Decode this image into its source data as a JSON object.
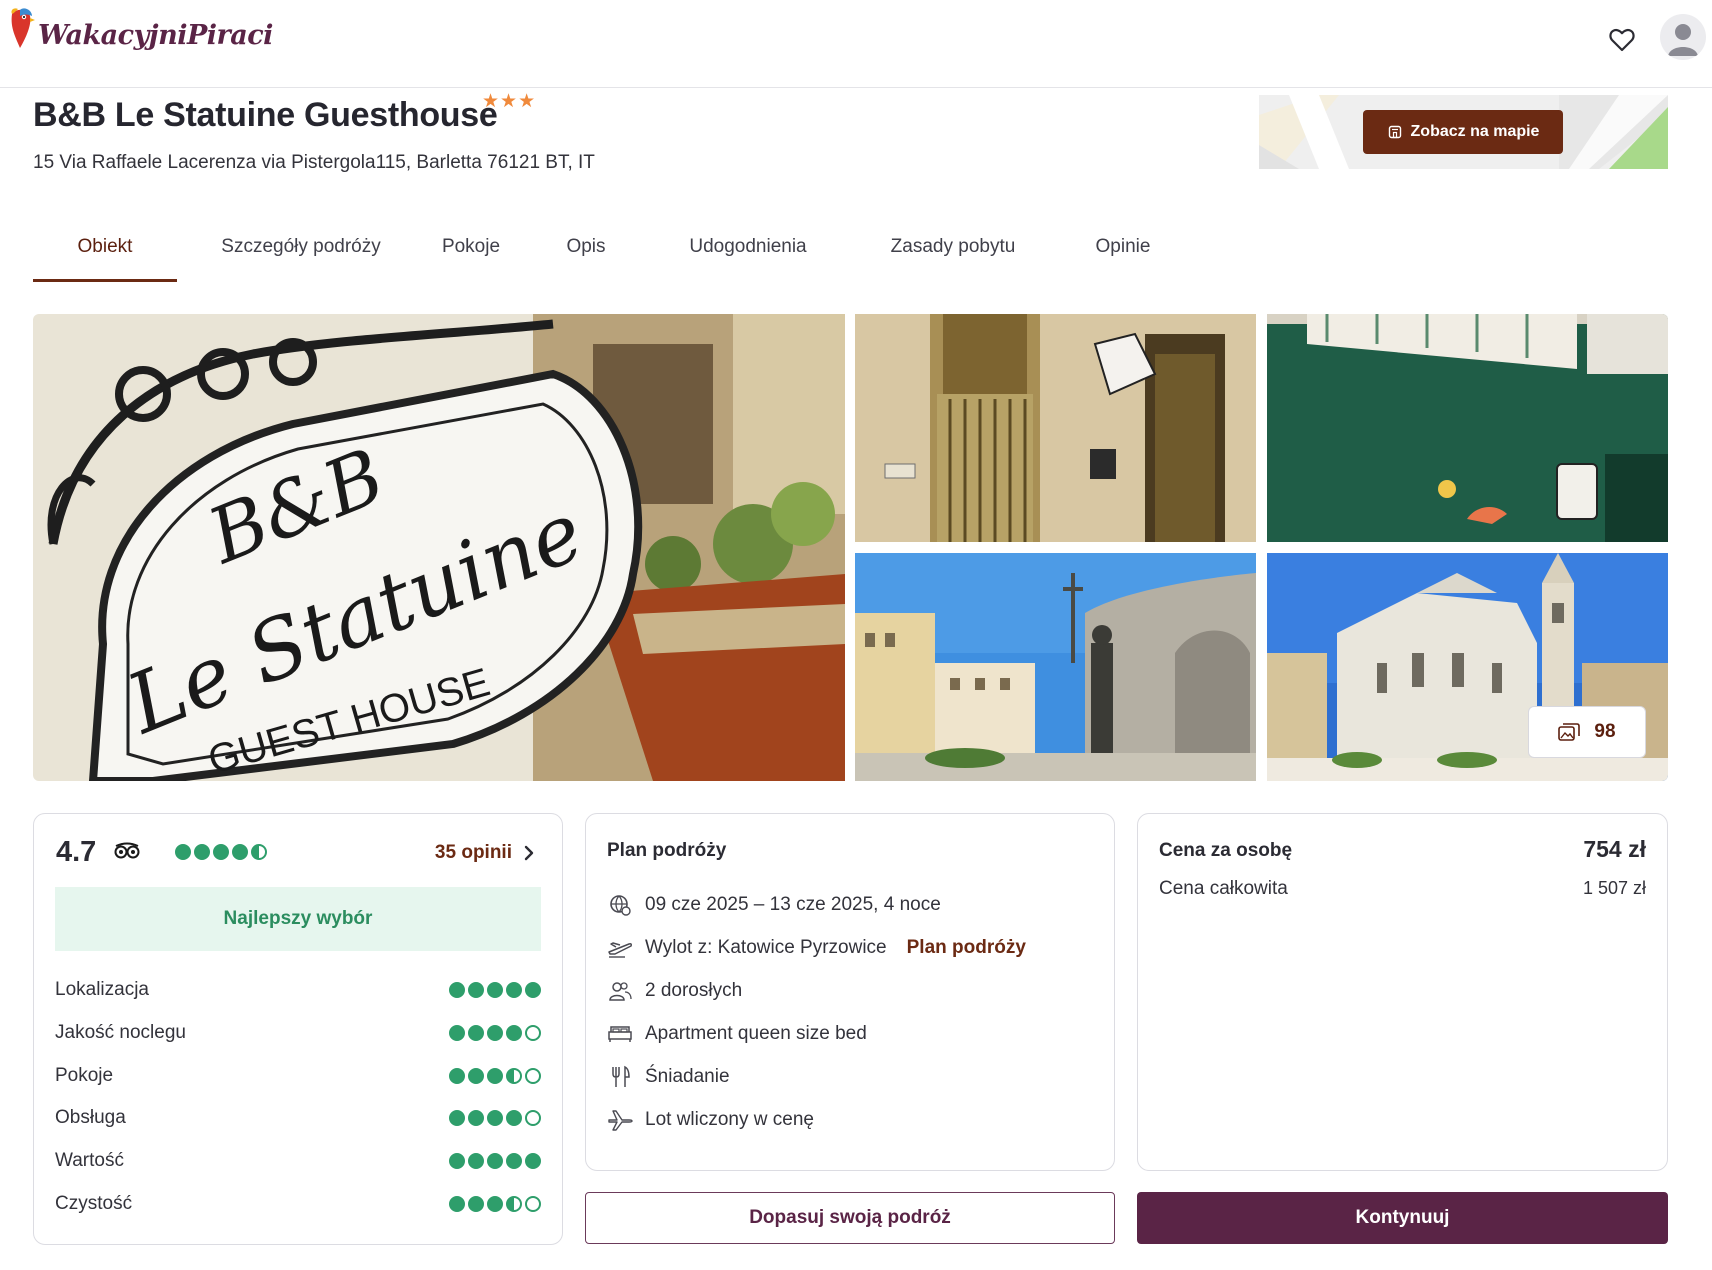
{
  "brand": {
    "logo_text": "WakacyjniPiraci",
    "primary_color": "#5a2446",
    "accent_color": "#6b2a13",
    "rating_color": "#2e9e6b"
  },
  "header": {
    "favorites_icon": "heart-icon",
    "account_icon": "user-icon"
  },
  "hotel": {
    "name": "B&B Le Statuine Guesthouse",
    "stars": "★★★",
    "star_count": 3,
    "address": "15 Via Raffaele Lacerenza via Pistergola115, Barletta 76121 BT, IT",
    "map_button": "Zobacz na mapie"
  },
  "tabs": [
    {
      "label": "Obiekt",
      "active": true
    },
    {
      "label": "Szczegóły podróży",
      "active": false
    },
    {
      "label": "Pokoje",
      "active": false
    },
    {
      "label": "Opis",
      "active": false
    },
    {
      "label": "Udogodnienia",
      "active": false
    },
    {
      "label": "Zasady pobytu",
      "active": false
    },
    {
      "label": "Opinie",
      "active": false
    }
  ],
  "gallery": {
    "photo_count": "98",
    "main_sign": {
      "line1": "B&B",
      "line2": "Le Statuine",
      "line3": "GUEST HOUSE"
    }
  },
  "rating": {
    "score": "4.7",
    "dots": 4.5,
    "opinions_link": "35 opinii",
    "badge": "Najlepszy wybór",
    "criteria": [
      {
        "label": "Lokalizacja",
        "dots": 5
      },
      {
        "label": "Jakość noclegu",
        "dots": 4
      },
      {
        "label": "Pokoje",
        "dots": 3.5
      },
      {
        "label": "Obsługa",
        "dots": 4
      },
      {
        "label": "Wartość",
        "dots": 5
      },
      {
        "label": "Czystość",
        "dots": 3.5
      }
    ]
  },
  "plan": {
    "title": "Plan podróży",
    "dates": "09 cze 2025 – 13 cze 2025, 4 noce",
    "departure": "Wylot z: Katowice Pyrzowice",
    "departure_link": "Plan podróży",
    "guests": "2 dorosłych",
    "room": "Apartment queen size bed",
    "board": "Śniadanie",
    "flight": "Lot wliczony w cenę"
  },
  "price": {
    "per_person_label": "Cena za osobę",
    "per_person_value": "754 zł",
    "total_label": "Cena całkowita",
    "total_value": "1 507 zł"
  },
  "actions": {
    "customize": "Dopasuj swoją podróż",
    "continue": "Kontynuuj"
  }
}
